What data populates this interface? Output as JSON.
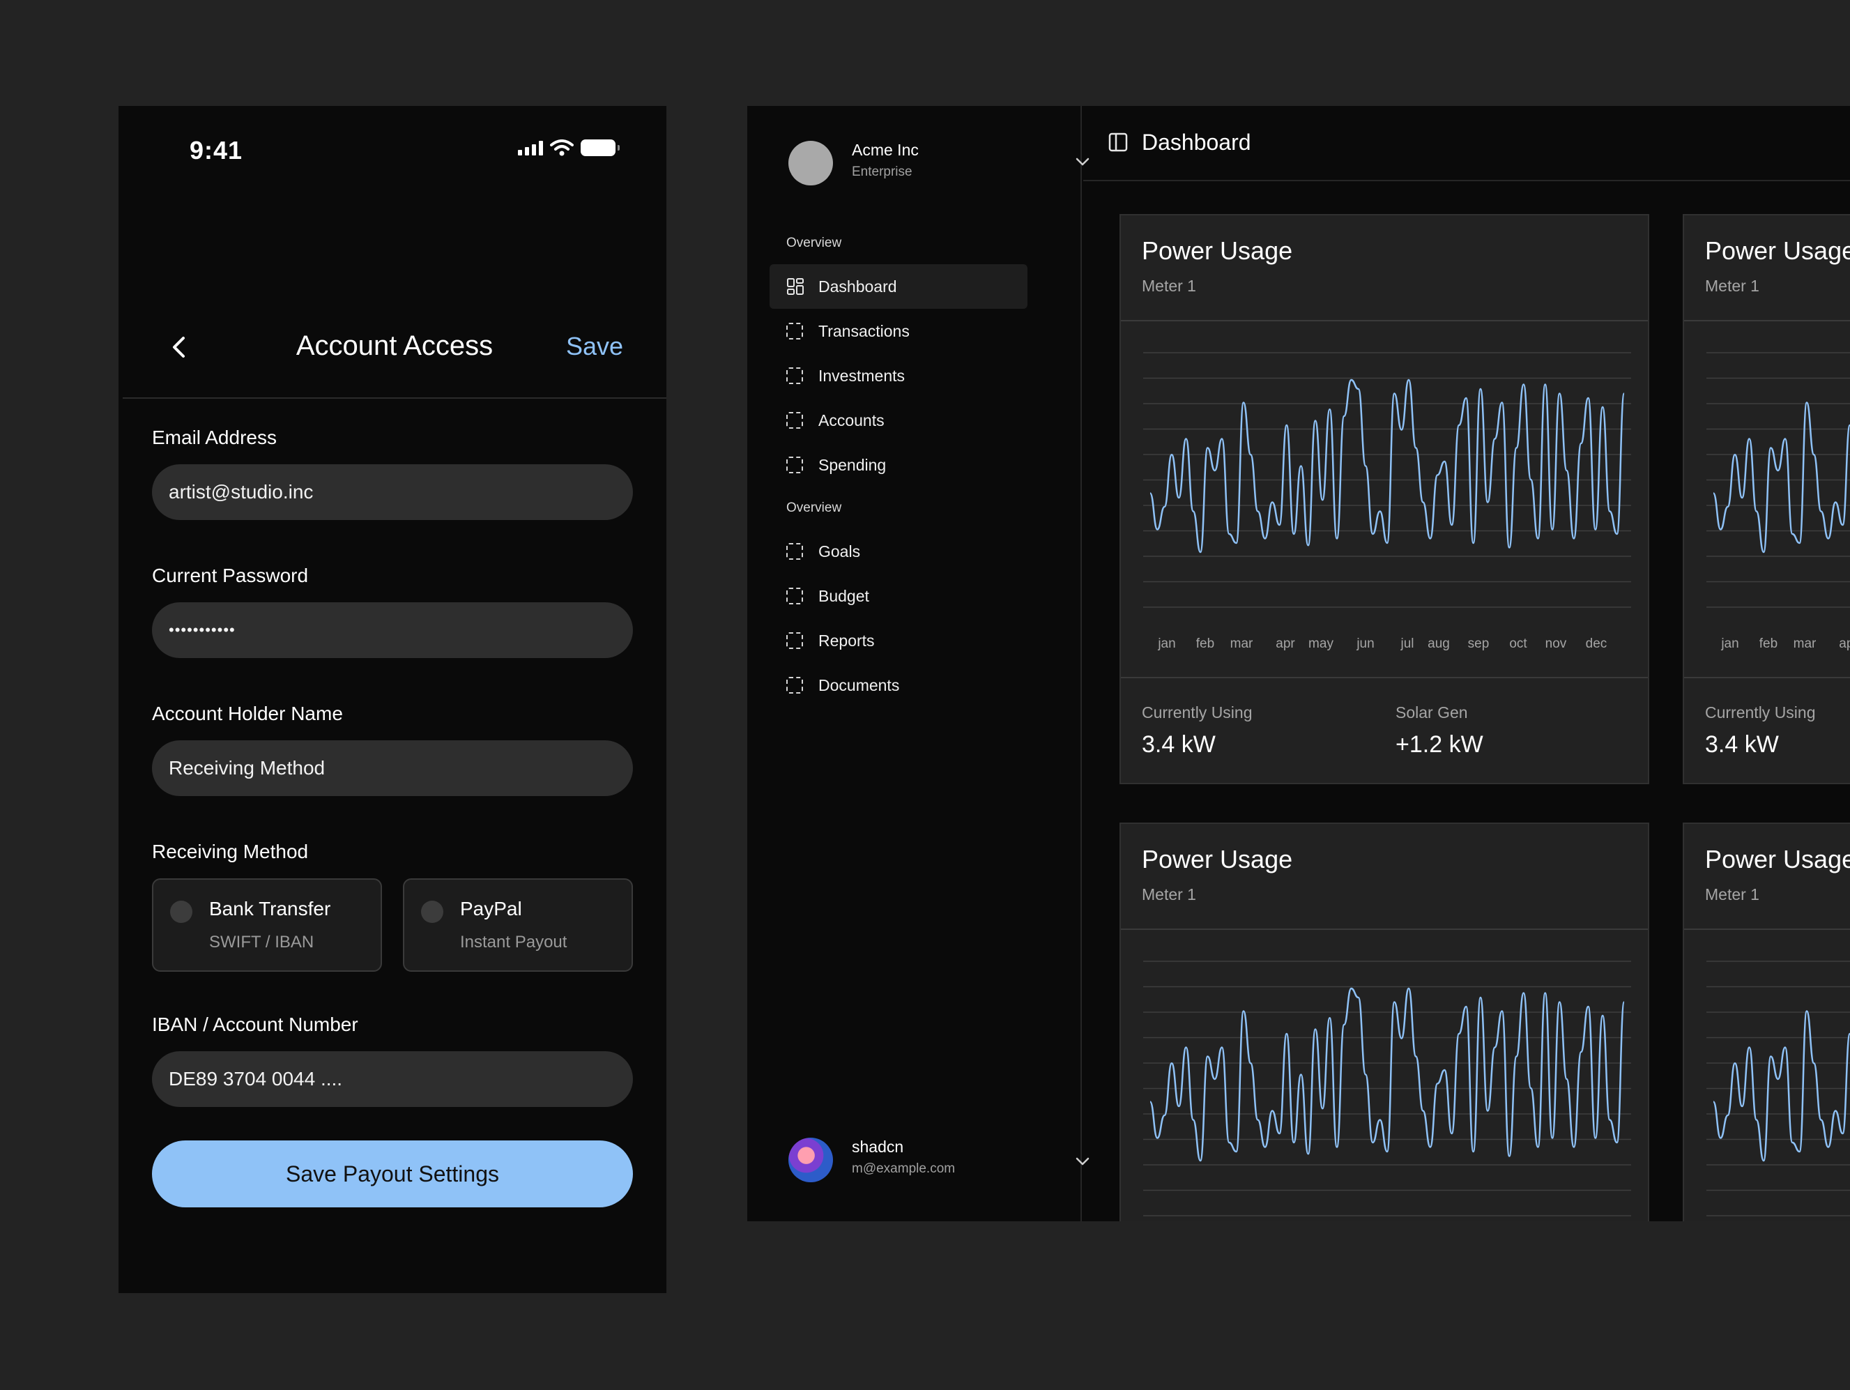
{
  "phone": {
    "status_time": "9:41",
    "nav": {
      "title": "Account Access",
      "save_label": "Save"
    },
    "fields": {
      "email": {
        "label": "Email Address",
        "value": "artist@studio.inc"
      },
      "password": {
        "label": "Current Password",
        "value": "•••••••••••"
      },
      "holder": {
        "label": "Account Holder Name",
        "value": "Receiving Method"
      },
      "method": {
        "label": "Receiving Method",
        "options": [
          {
            "title": "Bank Transfer",
            "subtitle": "SWIFT / IBAN"
          },
          {
            "title": "PayPal",
            "subtitle": "Instant Payout"
          }
        ]
      },
      "iban": {
        "label": "IBAN / Account Number",
        "value": "DE89 3704 0044 ...."
      }
    },
    "primary_button": "Save Payout Settings",
    "accent_color": "#8fc2f7"
  },
  "dashboard": {
    "team": {
      "name": "Acme Inc",
      "plan": "Enterprise"
    },
    "groups": [
      {
        "label": "Overview",
        "items": [
          "Dashboard",
          "Transactions",
          "Investments",
          "Accounts",
          "Spending"
        ]
      },
      {
        "label": "Overview",
        "items": [
          "Goals",
          "Budget",
          "Reports",
          "Documents"
        ]
      }
    ],
    "active_item": "Dashboard",
    "user": {
      "name": "shadcn",
      "email": "m@example.com"
    },
    "topbar_title": "Dashboard",
    "cards": [
      {
        "title": "Power Usage",
        "subtitle": "Meter 1",
        "stats": [
          {
            "label": "Currently Using",
            "value": "3.4 kW"
          },
          {
            "label": "Solar Gen",
            "value": "+1.2 kW"
          }
        ]
      },
      {
        "title": "Power Usage",
        "subtitle": "Meter 1",
        "stats": [
          {
            "label": "Currently Using",
            "value": "3.4 kW"
          }
        ]
      },
      {
        "title": "Power Usage",
        "subtitle": "Meter 1"
      },
      {
        "title": "Power Usage",
        "subtitle": "Meter 1"
      }
    ]
  },
  "chart_data": {
    "type": "line",
    "x": [
      "jan",
      "feb",
      "mar",
      "apr",
      "may",
      "jun",
      "jul",
      "aug",
      "sep",
      "oct",
      "nov",
      "dec"
    ],
    "series_color": "#8fc2f7",
    "grid": true,
    "values": [
      0.38,
      0.22,
      0.32,
      0.55,
      0.36,
      0.62,
      0.3,
      0.12,
      0.58,
      0.48,
      0.62,
      0.2,
      0.16,
      0.78,
      0.55,
      0.3,
      0.18,
      0.34,
      0.24,
      0.68,
      0.2,
      0.5,
      0.15,
      0.7,
      0.35,
      0.75,
      0.18,
      0.72,
      0.88,
      0.84,
      0.5,
      0.2,
      0.3,
      0.16,
      0.82,
      0.66,
      0.88,
      0.58,
      0.34,
      0.18,
      0.46,
      0.52,
      0.24,
      0.68,
      0.8,
      0.16,
      0.84,
      0.34,
      0.62,
      0.78,
      0.14,
      0.58,
      0.86,
      0.44,
      0.18,
      0.86,
      0.22,
      0.82,
      0.48,
      0.18,
      0.6,
      0.8,
      0.22,
      0.76,
      0.3,
      0.2,
      0.82
    ]
  }
}
